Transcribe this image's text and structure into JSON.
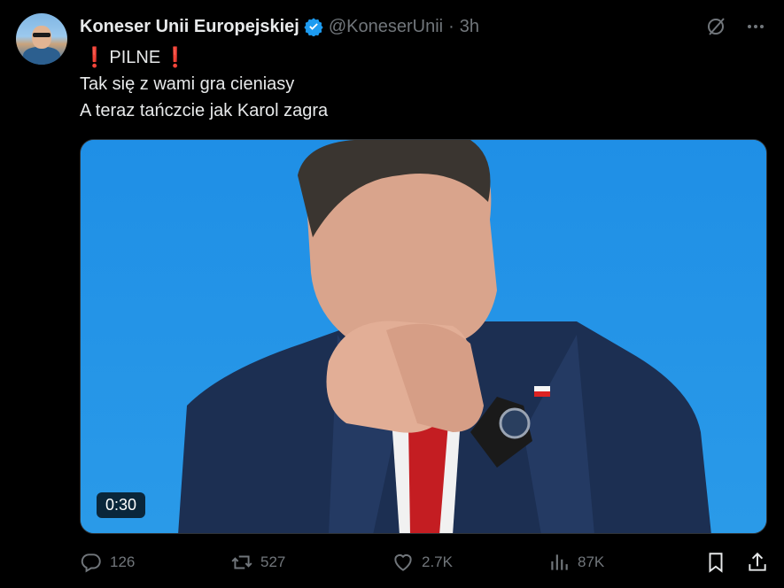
{
  "author": {
    "name": "Koneser Unii Europejskiej",
    "handle": "@KoneserUnii",
    "separator": "·",
    "time": "3h"
  },
  "tweet": {
    "line1": "PILNE",
    "line2": "Tak się z wami gra cieniasy",
    "line3": "A teraz tańczcie jak Karol zagra"
  },
  "media": {
    "duration": "0:30"
  },
  "actions": {
    "replies": "126",
    "reposts": "527",
    "likes": "2.7K",
    "views": "87K"
  },
  "colors": {
    "accent": "#1d9bf0",
    "alert": "#e0245e",
    "muted": "#71767b"
  },
  "icons": [
    "verified-badge-icon",
    "grok-icon",
    "more-icon",
    "reply-icon",
    "repost-icon",
    "like-icon",
    "views-icon",
    "bookmark-icon",
    "share-icon"
  ]
}
